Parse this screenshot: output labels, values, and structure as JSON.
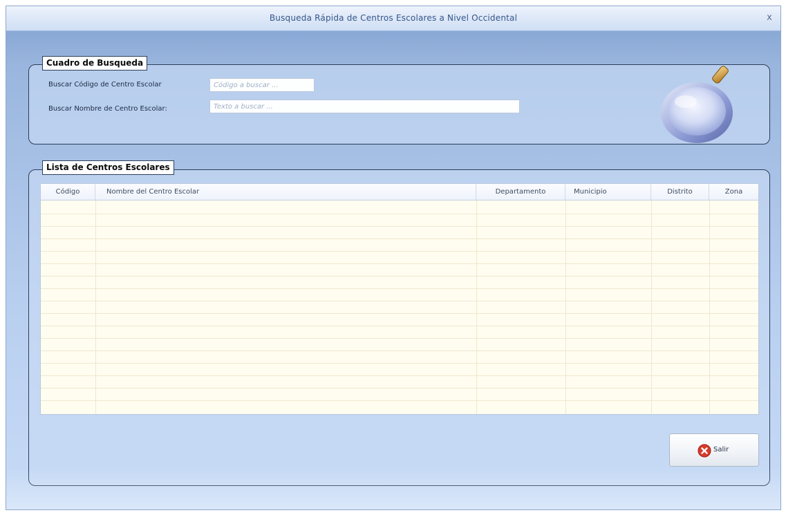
{
  "window": {
    "title": "Busqueda Rápida de Centros Escolares a Nivel Occidental",
    "close_label": "x"
  },
  "search_box": {
    "legend": "Cuadro de Busqueda",
    "code_label": "Buscar Código de Centro Escolar",
    "code_placeholder": "Código a buscar ...",
    "code_value": "",
    "name_label": "Buscar Nombre de Centro Escolar:",
    "name_placeholder": "Texto a buscar ...",
    "name_value": "",
    "icon": "magnifier-icon"
  },
  "school_list": {
    "legend": "Lista de Centros Escolares",
    "columns": [
      "Código",
      "Nombre del Centro Escolar",
      "Departamento",
      "Municipio",
      "Distrito",
      "Zona"
    ],
    "rows": []
  },
  "exit_button": {
    "label": "Salir",
    "icon": "close-circle-icon"
  },
  "colors": {
    "window_bg": "#a9c3e8",
    "title_text": "#35568a",
    "group_border": "#2c3e5a",
    "grid_bg": "#fffdf0",
    "exit_icon": "#d93a2b"
  }
}
